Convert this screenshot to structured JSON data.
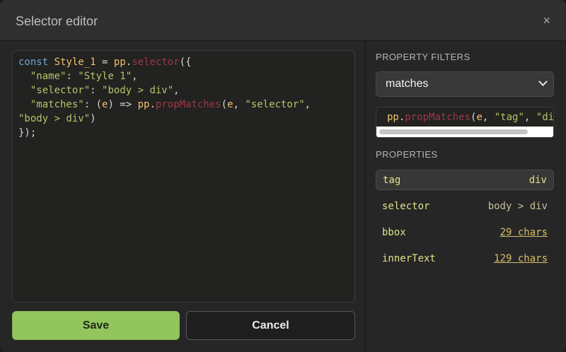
{
  "dialog": {
    "title": "Selector editor",
    "close_label": "×"
  },
  "editor": {
    "line1": {
      "kw": "const",
      "name": "Style_1",
      "eq": " = ",
      "obj": "pp",
      "dot": ".",
      "fn": "selector",
      "tail": "({"
    },
    "line2": {
      "indent": "  ",
      "key": "\"name\"",
      "colon": ": ",
      "val": "\"Style 1\"",
      "comma": ","
    },
    "line3": {
      "indent": "  ",
      "key": "\"selector\"",
      "colon": ": ",
      "val": "\"body > div\"",
      "comma": ","
    },
    "line4": {
      "indent": "  ",
      "key": "\"matches\"",
      "colon": ": (",
      "arg": "e",
      "arrow": ") => ",
      "obj": "pp",
      "dot": ".",
      "fn": "propMatches",
      "open": "(",
      "arg2": "e",
      "sep": ", ",
      "val": "\"selector\"",
      "comma": ","
    },
    "line5": {
      "val": "\"body > div\"",
      "close": ")"
    },
    "line6": {
      "text": "});"
    }
  },
  "actions": {
    "save_label": "Save",
    "cancel_label": "Cancel"
  },
  "property_filters": {
    "heading": "PROPERTY FILTERS",
    "selected_option": "matches",
    "code": {
      "obj": "pp",
      "dot": ".",
      "fn": "propMatches",
      "open": "(",
      "arg": "e",
      "sep": ", ",
      "val1": "\"tag\"",
      "sep2": ", ",
      "val2": "\"di"
    }
  },
  "properties": {
    "heading": "PROPERTIES",
    "items": [
      {
        "key": "tag",
        "value": "div"
      },
      {
        "key": "selector",
        "value": "body > div"
      },
      {
        "key": "bbox",
        "value": "29 chars"
      },
      {
        "key": "innerText",
        "value": "129 chars"
      }
    ]
  }
}
